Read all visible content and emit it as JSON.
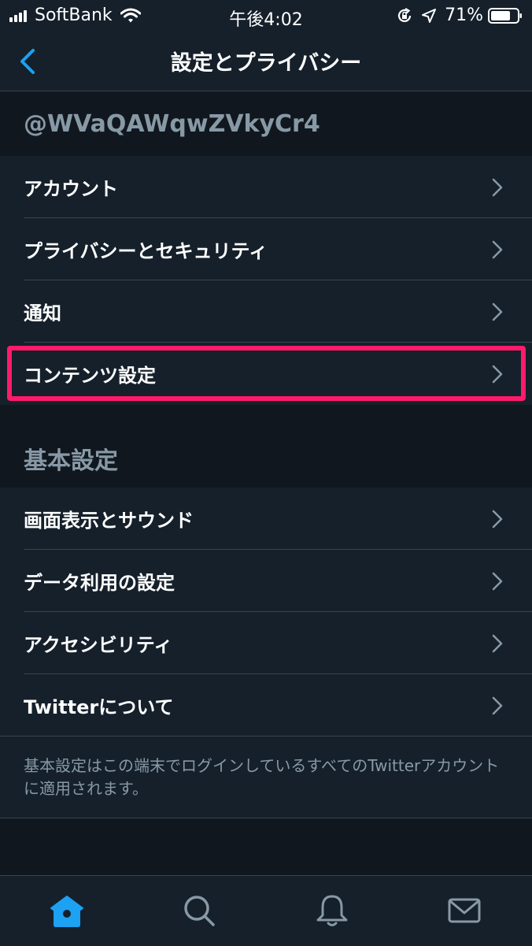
{
  "colors": {
    "background": "#15202b",
    "accent": "#1da1f2",
    "highlight": "#ff1a6a",
    "muted": "#8899a6"
  },
  "status_bar": {
    "carrier": "SoftBank",
    "time": "午後4:02",
    "battery": "71%"
  },
  "nav": {
    "title": "設定とプライバシー",
    "back_icon": "chevron-left-icon"
  },
  "account_section": {
    "header": "@WVaQAWqwZVkyCr4",
    "items": [
      {
        "label": "アカウント"
      },
      {
        "label": "プライバシーとセキュリティ"
      },
      {
        "label": "通知"
      },
      {
        "label": "コンテンツ設定"
      }
    ]
  },
  "general_section": {
    "header": "基本設定",
    "items": [
      {
        "label": "画面表示とサウンド"
      },
      {
        "label": "データ利用の設定"
      },
      {
        "label": "アクセシビリティ"
      },
      {
        "label": "Twitterについて"
      }
    ],
    "footnote": "基本設定はこの端末でログインしているすべてのTwitterアカウントに適用されます。"
  },
  "tab_bar": {
    "tabs": [
      "home-icon",
      "search-icon",
      "bell-icon",
      "mail-icon"
    ],
    "active": "home-icon"
  }
}
